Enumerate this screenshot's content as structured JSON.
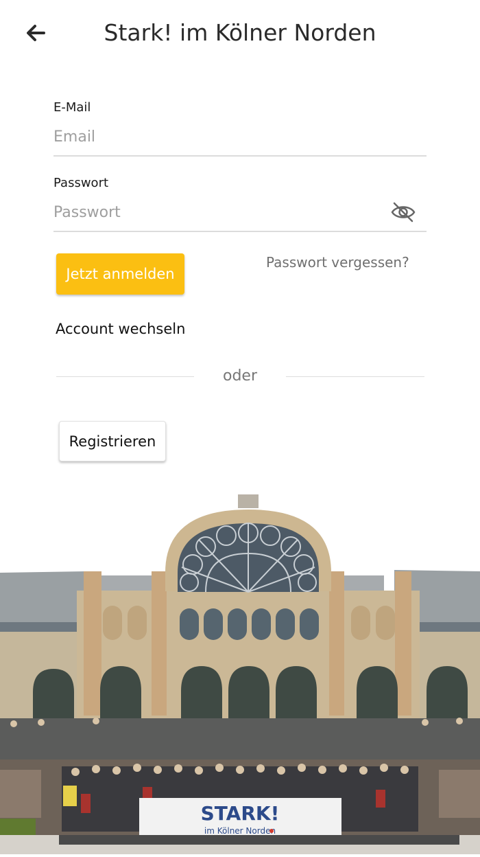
{
  "header": {
    "title": "Stark! im Kölner Norden",
    "back_icon": "arrow-left-icon"
  },
  "form": {
    "email": {
      "label": "E-Mail",
      "placeholder": "Email",
      "value": ""
    },
    "password": {
      "label": "Passwort",
      "placeholder": "Passwort",
      "value": "",
      "toggle_icon": "eye-slash-icon"
    },
    "login_label": "Jetzt anmelden",
    "forgot_label": "Passwort vergessen?",
    "switch_account_label": "Account wechseln",
    "divider_text": "oder",
    "register_label": "Registrieren"
  },
  "photo": {
    "banner_title": "STARK!",
    "banner_subtitle": "im Kölner Norden"
  },
  "colors": {
    "accent": "#fbbf12",
    "muted_text": "#777777",
    "divider": "#dddddd"
  }
}
